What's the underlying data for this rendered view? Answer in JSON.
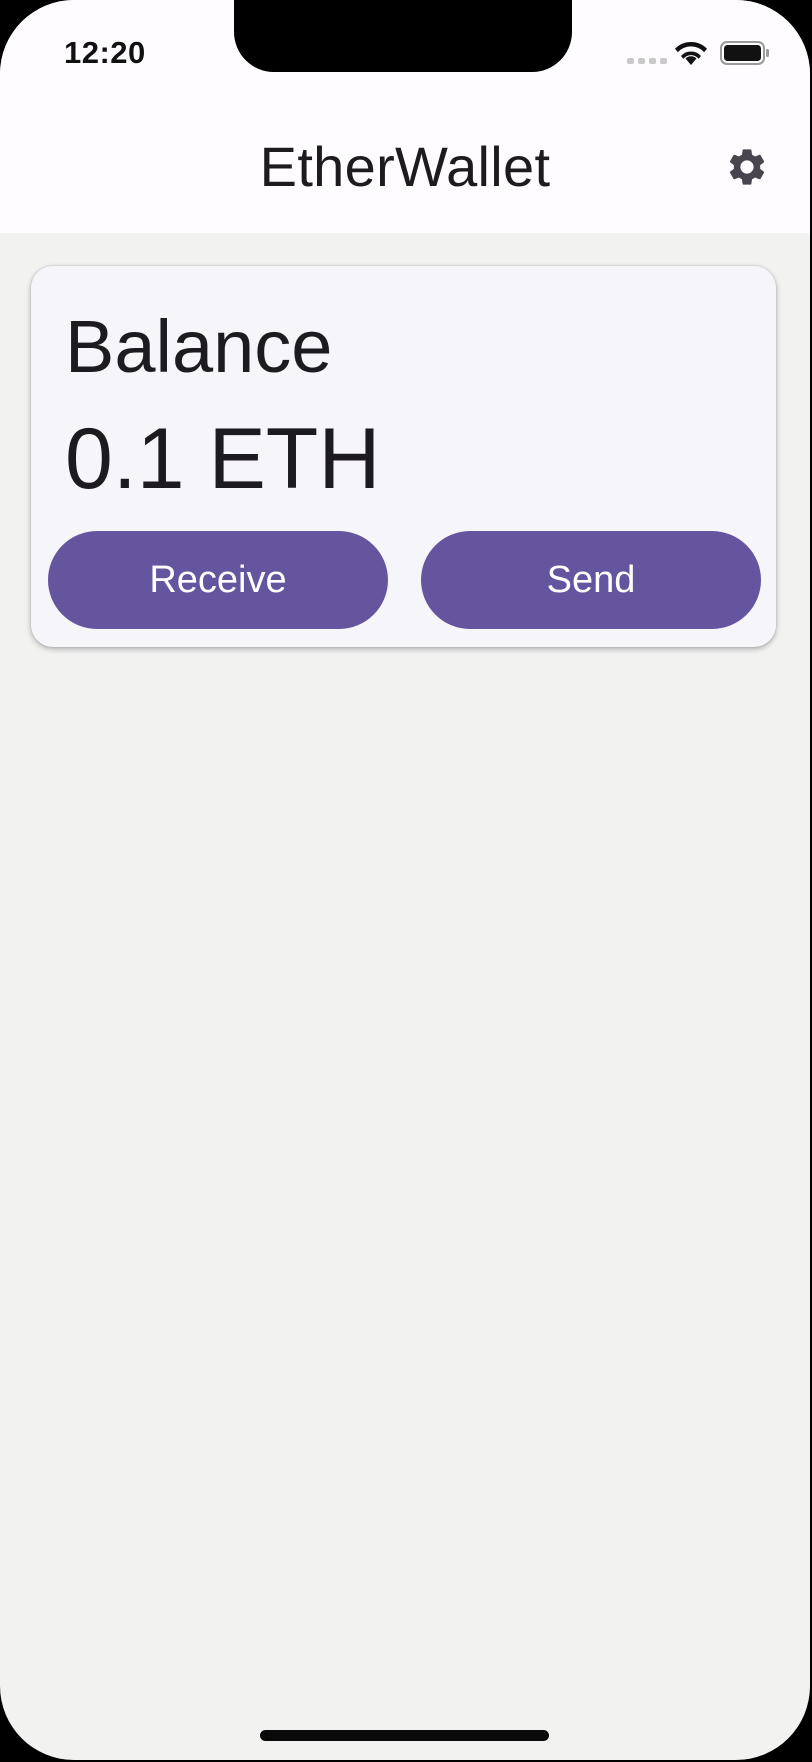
{
  "status_bar": {
    "time": "12:20"
  },
  "nav": {
    "title": "EtherWallet",
    "settings_icon": "gear-icon"
  },
  "balance_card": {
    "label": "Balance",
    "value": "0.1 ETH",
    "receive_label": "Receive",
    "send_label": "Send"
  },
  "colors": {
    "accent": "#65559f",
    "background": "#f2f2f1",
    "card": "#f6f5f9",
    "bar": "#fefcff",
    "text": "#1d1b20"
  }
}
